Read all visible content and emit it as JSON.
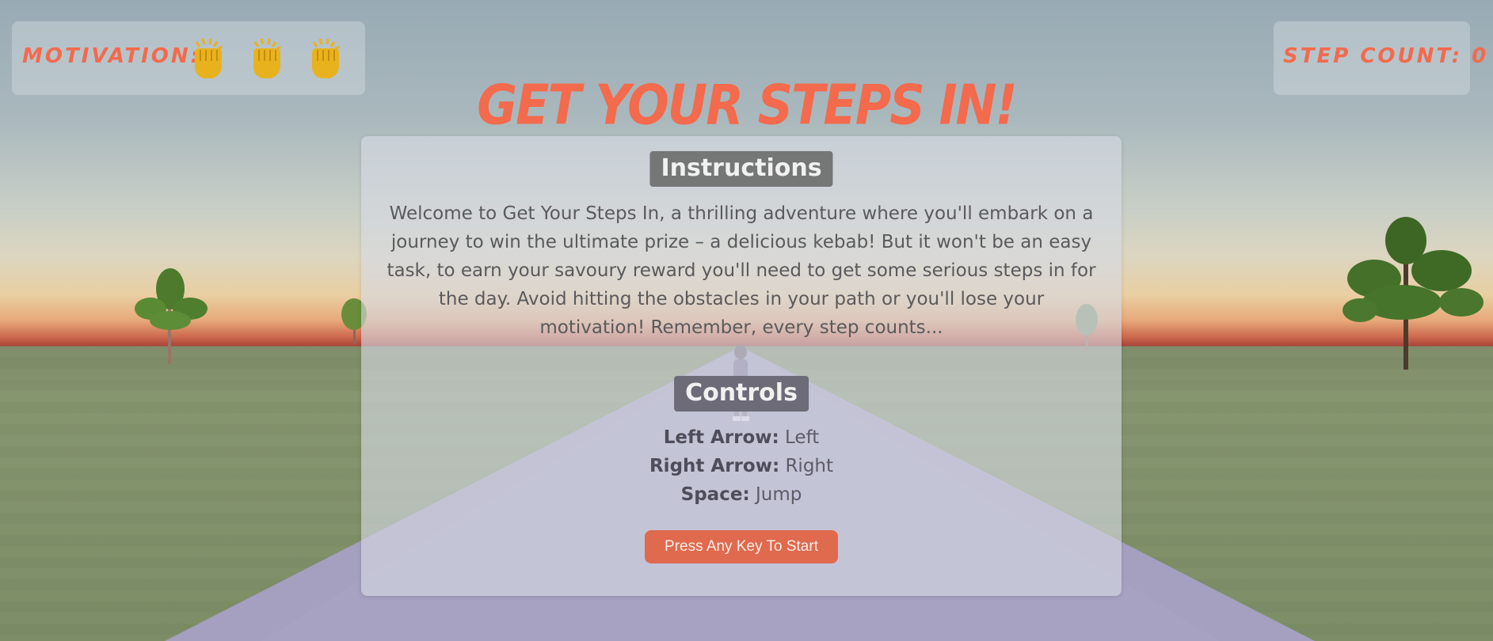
{
  "game": {
    "title": "GET YOUR STEPS IN!"
  },
  "hud": {
    "motivation_label": "MOTIVATION:",
    "motivation_icons": [
      "fist-icon",
      "fist-icon",
      "fist-icon"
    ],
    "step_count_label": "STEP COUNT: 0"
  },
  "panel": {
    "instructions_heading": "Instructions",
    "welcome_text": "Welcome to Get Your Steps In, a thrilling adventure where you'll embark on a journey to win the ultimate prize – a delicious kebab! But it won't be an easy task, to earn your savoury reward you'll need to get some serious steps in for the day. Avoid hitting the obstacles in your path or you'll lose your motivation! Remember, every step counts...",
    "controls_heading": "Controls",
    "controls": [
      {
        "key": "Left Arrow:",
        "action": "Left"
      },
      {
        "key": "Right Arrow:",
        "action": "Right"
      },
      {
        "key": "Space:",
        "action": "Jump"
      }
    ],
    "start_button": "Press Any Key To Start"
  },
  "colors": {
    "title": "#f36a4c",
    "start_button": "#df6a4e",
    "road": "#a59fc0",
    "fist": "#e8b21f"
  }
}
